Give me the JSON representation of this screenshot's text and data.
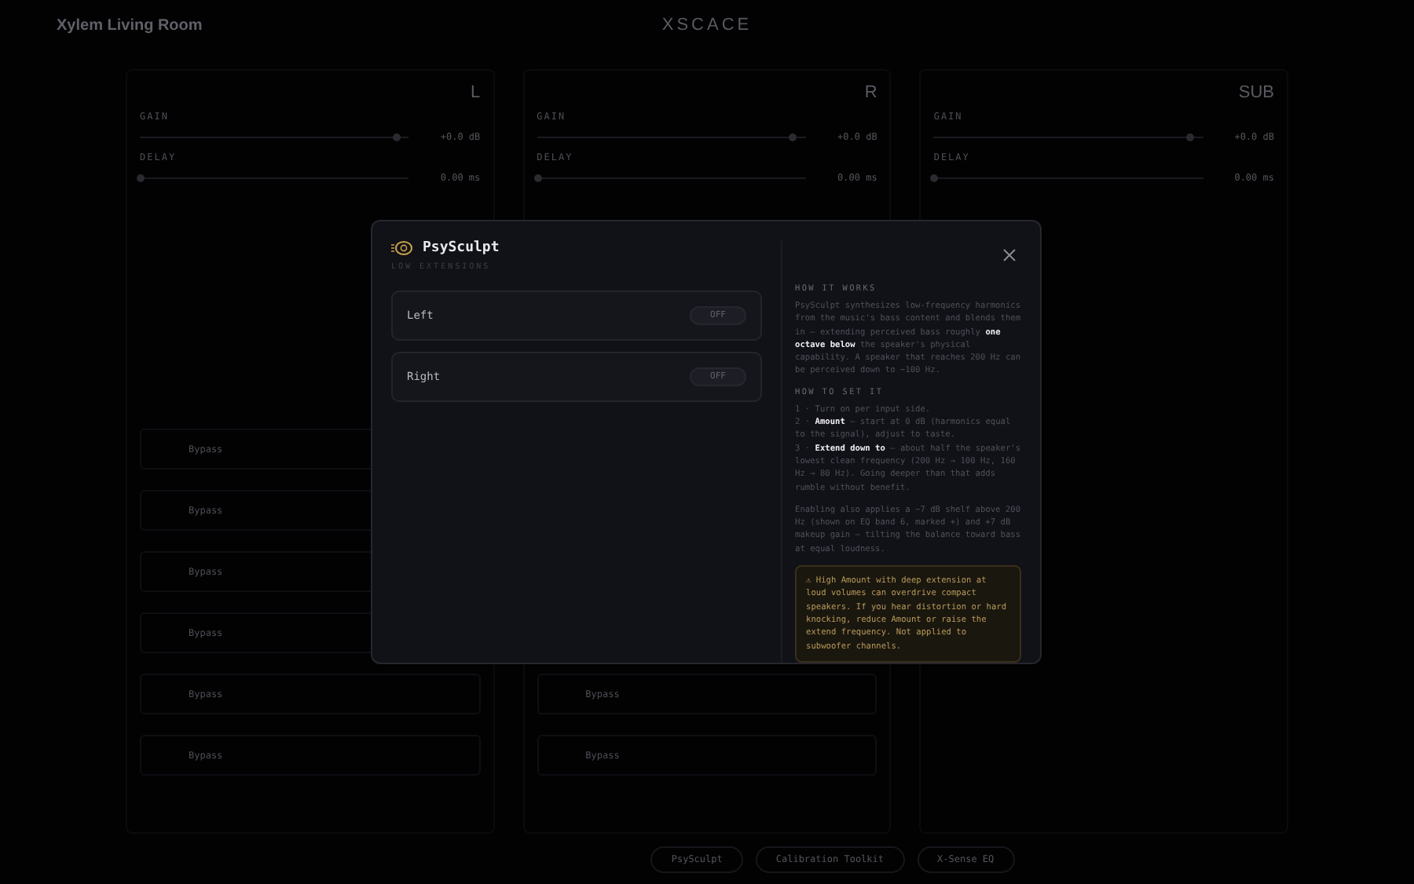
{
  "header": {
    "room": "Xylem Living Room",
    "brand": "XSCACE"
  },
  "channels": [
    {
      "letter": "L",
      "gain": {
        "label": "GAIN",
        "level": 0.95,
        "reading": "+0.0 dB"
      },
      "delay": {
        "label": "DELAY",
        "level": 0,
        "reading": "0.00 ms"
      },
      "eq_bands": [
        "Bypass",
        "Bypass",
        "Bypass",
        "Bypass",
        "Bypass",
        "Bypass"
      ]
    },
    {
      "letter": "R",
      "gain": {
        "label": "GAIN",
        "level": 0.95,
        "reading": "+0.0 dB"
      },
      "delay": {
        "label": "DELAY",
        "level": 0,
        "reading": "0.00 ms"
      },
      "eq_bands": [
        "Bypass",
        "Bypass"
      ]
    },
    {
      "letter": "SUB",
      "gain": {
        "label": "GAIN",
        "level": 0.95,
        "reading": "+0.0 dB"
      },
      "delay": {
        "label": "DELAY",
        "level": 0,
        "reading": "0.00 ms"
      }
    }
  ],
  "tools": [
    "PsySculpt",
    "Calibration Toolkit",
    "X-Sense EQ"
  ],
  "modal": {
    "title": "PsySculpt",
    "subtitle": "LOW EXTENSIONS",
    "sides": [
      {
        "name": "Left",
        "on": false,
        "state": "OFF"
      },
      {
        "name": "Right",
        "on": false,
        "state": "OFF"
      }
    ],
    "how_heading": "HOW IT WORKS",
    "how_text": "PsySculpt synthesizes low-frequency harmonics from the music's bass content and blends them in — extending perceived bass roughly **one octave below** the speaker's physical capability. A speaker that reaches 200 Hz can be perceived down to ~100 Hz.",
    "set_heading": "HOW TO SET IT",
    "steps": [
      "1 · Turn on per input side.",
      "2 · **Amount** — start at 0 dB (harmonics equal to the signal), adjust to taste.",
      "3 · **Extend down to** — about half the speaker's lowest clean frequency (200 Hz → 100 Hz, 160 Hz → 80 Hz). Going deeper than that adds rumble without benefit."
    ],
    "note": "Enabling also applies a −7 dB shelf above 200 Hz (shown on EQ band 6, marked +) and +7 dB makeup gain — tilting the balance toward bass at equal loudness.",
    "warning": "⚠ High Amount with deep extension at loud volumes can overdrive compact speakers. If you hear distortion or hard knocking, reduce Amount or raise the extend frequency. Not applied to subwoofer channels."
  }
}
